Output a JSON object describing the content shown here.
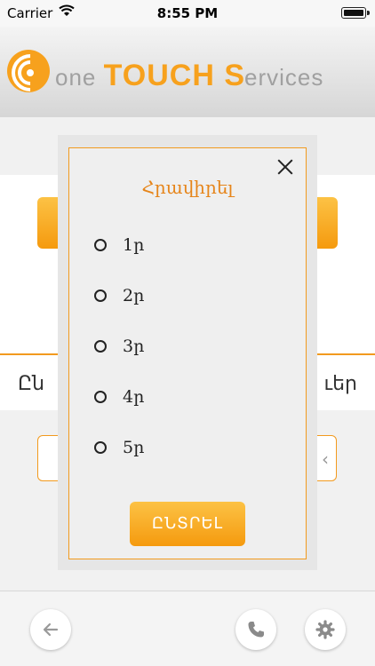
{
  "status": {
    "carrier": "Carrier",
    "time": "8:55 PM"
  },
  "logo": {
    "w1_first": "one ",
    "w2_first": "TOUCH ",
    "w3_first": "S",
    "w3_rest": "ervices"
  },
  "background": {
    "row_left": "Ըն",
    "row_right": "ւեր"
  },
  "modal": {
    "title": "Հրավիրել",
    "options": [
      "1ր",
      "2ր",
      "3ր",
      "4ր",
      "5ր"
    ],
    "select_label": "ԸՆՏՐԵԼ"
  },
  "colors": {
    "accent": "#f29a1e",
    "title": "#e6851a"
  }
}
